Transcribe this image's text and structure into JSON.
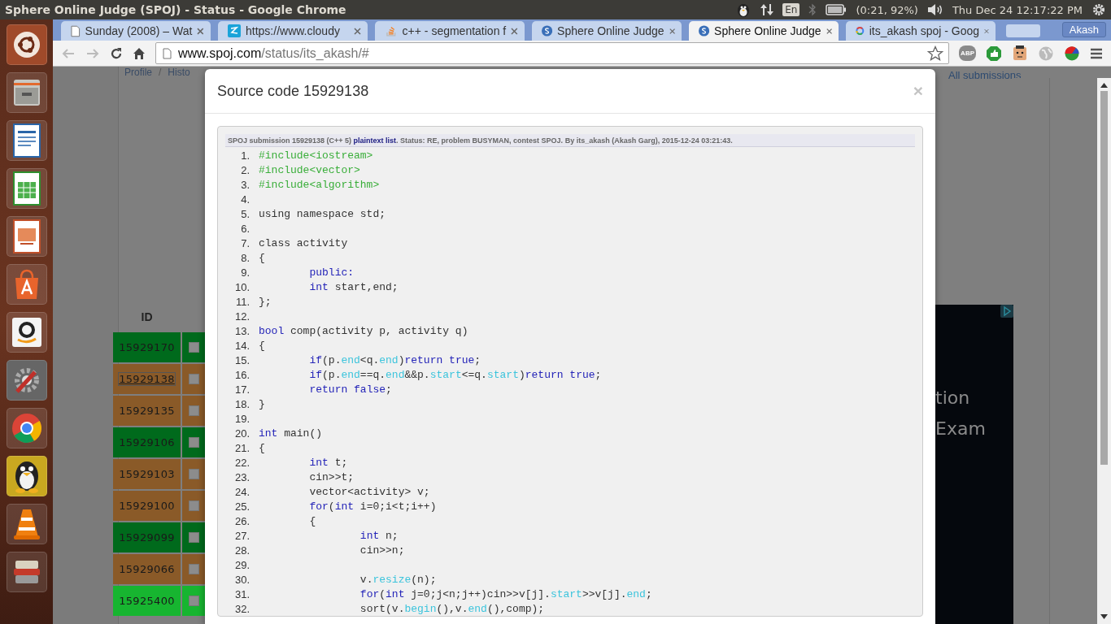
{
  "top_panel": {
    "title": "Sphere Online Judge (SPOJ) - Status - Google Chrome",
    "keyboard": "En",
    "battery": "(0:21, 92%)",
    "clock": "Thu Dec 24 12:17:22 PM"
  },
  "launcher": [
    {
      "kind": "ubuntu"
    },
    {
      "kind": "files"
    },
    {
      "kind": "writer"
    },
    {
      "kind": "calc"
    },
    {
      "kind": "impress"
    },
    {
      "kind": "software"
    },
    {
      "kind": "amazon"
    },
    {
      "kind": "settings"
    },
    {
      "kind": "chrome"
    },
    {
      "kind": "penguin"
    },
    {
      "kind": "vlc"
    },
    {
      "kind": "layers"
    }
  ],
  "tabs": [
    {
      "title": "Sunday (2008) – Wat",
      "selected": false
    },
    {
      "title": "https://www.cloudy",
      "selected": false
    },
    {
      "title": "c++ - segmentation f",
      "selected": false
    },
    {
      "title": "Sphere Online Judge",
      "selected": false
    },
    {
      "title": "Sphere Online Judge",
      "selected": true
    },
    {
      "title": "its_akash spoj - Goog",
      "selected": false
    }
  ],
  "profile": "Akash",
  "address": {
    "host": "www.spoj.com",
    "path": "/status/its_akash/#"
  },
  "extensions": {
    "abp": "ABP"
  },
  "page": {
    "breadcrumb": [
      "Profile",
      "Histo"
    ],
    "separator": "/",
    "all_link": "All submissions",
    "id_header": "ID",
    "rows": [
      {
        "id": "15929170",
        "color": "#006a1c",
        "selected": false,
        "checked": false
      },
      {
        "id": "15929138",
        "color": "#8a5a28",
        "selected": true,
        "checked": false
      },
      {
        "id": "15929135",
        "color": "#8a5a28",
        "selected": false,
        "checked": false
      },
      {
        "id": "15929106",
        "color": "#006a1c",
        "selected": false,
        "checked": false
      },
      {
        "id": "15929103",
        "color": "#8a5a28",
        "selected": false,
        "checked": false
      },
      {
        "id": "15929100",
        "color": "#8a5a28",
        "selected": false,
        "checked": false
      },
      {
        "id": "15929099",
        "color": "#006a1c",
        "selected": false,
        "checked": false
      },
      {
        "id": "15929066",
        "color": "#8a5a28",
        "selected": false,
        "checked": false
      },
      {
        "id": "15925400",
        "color": "#17b530",
        "selected": false,
        "checked": false
      }
    ],
    "ad": [
      "tion",
      "Exam"
    ]
  },
  "modal": {
    "title": "Source code 15929138",
    "close": "×",
    "info": {
      "prefix": "SPOJ submission 15929138 (C++ 5) ",
      "link": "plaintext list",
      "suffix": ". Status: RE, problem BUSYMAN, contest SPOJ. By its_akash (Akash Garg), 2015-12-24 03:21:43."
    },
    "lines": [
      {
        "number": "1.",
        "tokens": [
          {
            "kind": "directive",
            "text": "#include<iostream>"
          }
        ]
      },
      {
        "number": "2.",
        "tokens": [
          {
            "kind": "directive",
            "text": "#include<vector>"
          }
        ]
      },
      {
        "number": "3.",
        "tokens": [
          {
            "kind": "directive",
            "text": "#include<algorithm>"
          }
        ]
      },
      {
        "number": "4."
      },
      {
        "number": "5.",
        "tokens": [
          {
            "kind": "plain",
            "text": "using namespace std;"
          }
        ]
      },
      {
        "number": "6."
      },
      {
        "number": "7.",
        "tokens": [
          {
            "kind": "plain",
            "text": "class activity"
          }
        ]
      },
      {
        "number": "8.",
        "tokens": [
          {
            "kind": "plain",
            "text": "{"
          }
        ]
      },
      {
        "number": "9.",
        "tokens": [
          {
            "kind": "keyword",
            "text": "\tpublic:"
          }
        ]
      },
      {
        "number": "10.",
        "tokens": [
          {
            "kind": "keyword",
            "text": "\tint"
          },
          {
            "kind": "plain",
            "text": " start,end;"
          }
        ]
      },
      {
        "number": "11.",
        "tokens": [
          {
            "kind": "plain",
            "text": "};"
          }
        ]
      },
      {
        "number": "12."
      },
      {
        "number": "13.",
        "tokens": [
          {
            "kind": "keyword",
            "text": "bool"
          },
          {
            "kind": "plain",
            "text": " comp(activity p, activity q)"
          }
        ]
      },
      {
        "number": "14.",
        "tokens": [
          {
            "kind": "plain",
            "text": "{"
          }
        ]
      },
      {
        "number": "15.",
        "tokens": [
          {
            "kind": "keyword",
            "text": "\tif"
          },
          {
            "kind": "plain",
            "text": "(p."
          },
          {
            "kind": "member",
            "text": "end"
          },
          {
            "kind": "plain",
            "text": "<q."
          },
          {
            "kind": "member",
            "text": "end"
          },
          {
            "kind": "plain",
            "text": ")"
          },
          {
            "kind": "keyword",
            "text": "return true"
          },
          {
            "kind": "plain",
            "text": ";"
          }
        ]
      },
      {
        "number": "16.",
        "tokens": [
          {
            "kind": "keyword",
            "text": "\tif"
          },
          {
            "kind": "plain",
            "text": "(p."
          },
          {
            "kind": "member",
            "text": "end"
          },
          {
            "kind": "plain",
            "text": "==q."
          },
          {
            "kind": "member",
            "text": "end"
          },
          {
            "kind": "plain",
            "text": "&&p."
          },
          {
            "kind": "member",
            "text": "start"
          },
          {
            "kind": "plain",
            "text": "<=q."
          },
          {
            "kind": "member",
            "text": "start"
          },
          {
            "kind": "plain",
            "text": ")"
          },
          {
            "kind": "keyword",
            "text": "return true"
          },
          {
            "kind": "plain",
            "text": ";"
          }
        ]
      },
      {
        "number": "17.",
        "tokens": [
          {
            "kind": "keyword",
            "text": "\treturn false"
          },
          {
            "kind": "plain",
            "text": ";"
          }
        ]
      },
      {
        "number": "18.",
        "tokens": [
          {
            "kind": "plain",
            "text": "}"
          }
        ]
      },
      {
        "number": "19."
      },
      {
        "number": "20.",
        "tokens": [
          {
            "kind": "keyword",
            "text": "int"
          },
          {
            "kind": "plain",
            "text": " main()"
          }
        ]
      },
      {
        "number": "21.",
        "tokens": [
          {
            "kind": "plain",
            "text": "{"
          }
        ]
      },
      {
        "number": "22.",
        "tokens": [
          {
            "kind": "keyword",
            "text": "\tint"
          },
          {
            "kind": "plain",
            "text": " t;"
          }
        ]
      },
      {
        "number": "23.",
        "tokens": [
          {
            "kind": "plain",
            "text": "\tcin>>t;"
          }
        ]
      },
      {
        "number": "24.",
        "tokens": [
          {
            "kind": "plain",
            "text": "\tvector<activity> v;"
          }
        ]
      },
      {
        "number": "25.",
        "tokens": [
          {
            "kind": "keyword",
            "text": "\tfor"
          },
          {
            "kind": "plain",
            "text": "("
          },
          {
            "kind": "keyword",
            "text": "int"
          },
          {
            "kind": "plain",
            "text": " i=0;i<t;i++)"
          }
        ]
      },
      {
        "number": "26.",
        "tokens": [
          {
            "kind": "plain",
            "text": "\t{"
          }
        ]
      },
      {
        "number": "27.",
        "tokens": [
          {
            "kind": "keyword",
            "text": "\t\tint"
          },
          {
            "kind": "plain",
            "text": " n;"
          }
        ]
      },
      {
        "number": "28.",
        "tokens": [
          {
            "kind": "plain",
            "text": "\t\tcin>>n;"
          }
        ]
      },
      {
        "number": "29."
      },
      {
        "number": "30.",
        "tokens": [
          {
            "kind": "plain",
            "text": "\t\tv."
          },
          {
            "kind": "member",
            "text": "resize"
          },
          {
            "kind": "plain",
            "text": "(n);"
          }
        ]
      },
      {
        "number": "31.",
        "tokens": [
          {
            "kind": "keyword",
            "text": "\t\tfor"
          },
          {
            "kind": "plain",
            "text": "("
          },
          {
            "kind": "keyword",
            "text": "int"
          },
          {
            "kind": "plain",
            "text": " j=0;j<n;j++)cin>>v[j]."
          },
          {
            "kind": "member",
            "text": "start"
          },
          {
            "kind": "plain",
            "text": ">>v[j]."
          },
          {
            "kind": "member",
            "text": "end"
          },
          {
            "kind": "plain",
            "text": ";"
          }
        ]
      },
      {
        "number": "32.",
        "tokens": [
          {
            "kind": "plain",
            "text": "\t\tsort(v."
          },
          {
            "kind": "member",
            "text": "begin"
          },
          {
            "kind": "plain",
            "text": "(),v."
          },
          {
            "kind": "member",
            "text": "end"
          },
          {
            "kind": "plain",
            "text": "(),comp);"
          }
        ]
      }
    ]
  }
}
